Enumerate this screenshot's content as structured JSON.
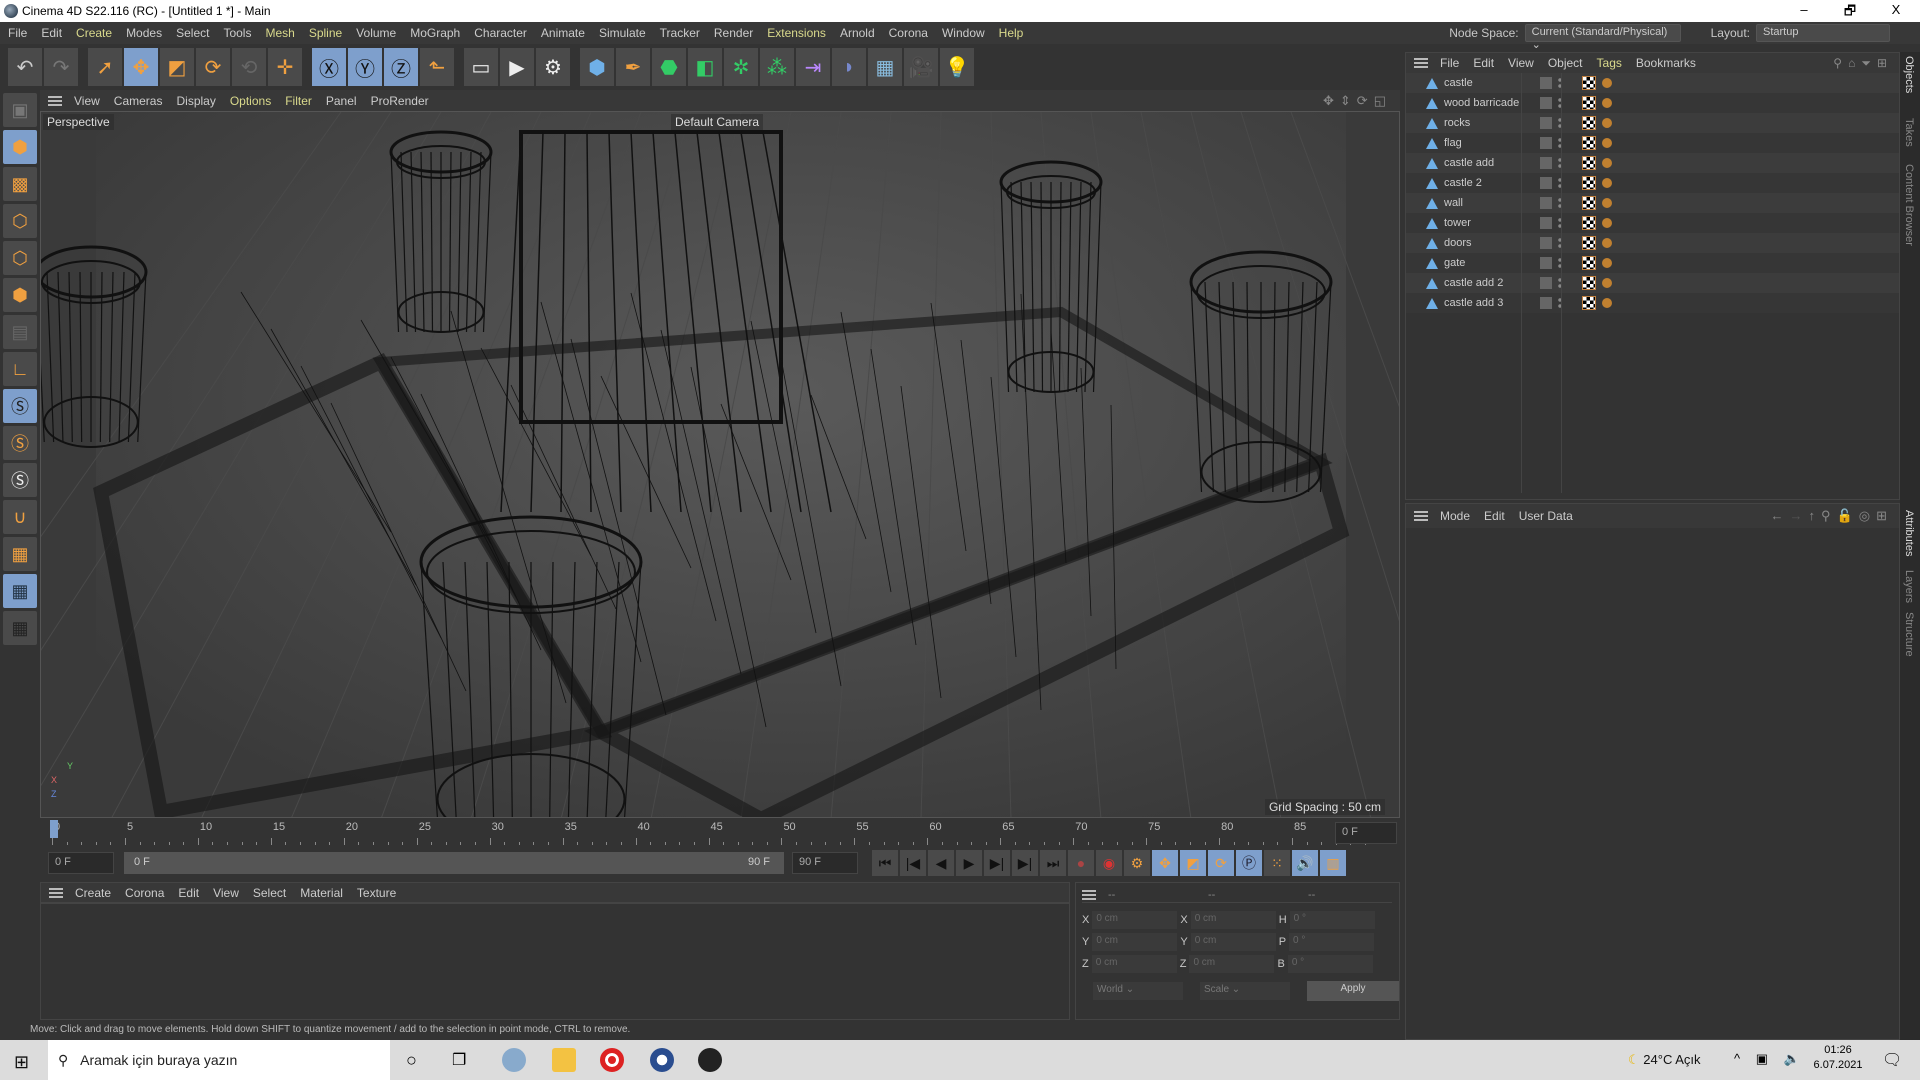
{
  "window": {
    "title": "Cinema 4D S22.116 (RC) - [Untitled 1 *] - Main",
    "minimize": "–",
    "maximize": "🗗",
    "close": "X"
  },
  "menu": [
    "File",
    "Edit",
    "Create",
    "Modes",
    "Select",
    "Tools",
    "Mesh",
    "Spline",
    "Volume",
    "MoGraph",
    "Character",
    "Animate",
    "Simulate",
    "Tracker",
    "Render",
    "Extensions",
    "Arnold",
    "Corona",
    "Window",
    "Help"
  ],
  "menu_highlight": [
    "Create",
    "Mesh",
    "Spline",
    "Extensions",
    "Help"
  ],
  "node_space": {
    "label": "Node Space:",
    "value": "Current (Standard/Physical)"
  },
  "layout": {
    "label": "Layout:",
    "value": "Startup"
  },
  "toolbar": [
    {
      "icon": "undo-icon",
      "g": "↶",
      "c": "#ccc"
    },
    {
      "icon": "redo-icon",
      "g": "↷",
      "c": "#777"
    },
    {
      "gap": true
    },
    {
      "icon": "live-selection-icon",
      "g": "➚",
      "on": false
    },
    {
      "icon": "move-icon",
      "g": "✥",
      "on": true
    },
    {
      "icon": "scale-icon",
      "g": "◩"
    },
    {
      "icon": "rotate-icon",
      "g": "⟳"
    },
    {
      "icon": "psr-icon",
      "g": "⟲",
      "c": "#666"
    },
    {
      "icon": "add-icon",
      "g": "✛"
    },
    {
      "gap": true
    },
    {
      "icon": "x-axis-icon",
      "g": "Ⓧ",
      "on": true,
      "c": "#111"
    },
    {
      "icon": "y-axis-icon",
      "g": "Ⓨ",
      "on": true,
      "c": "#111"
    },
    {
      "icon": "z-axis-icon",
      "g": "Ⓩ",
      "on": true,
      "c": "#111"
    },
    {
      "icon": "coordinate-system-icon",
      "g": "⬑"
    },
    {
      "gap": true
    },
    {
      "icon": "render-view-icon",
      "g": "▭",
      "c": "#eee"
    },
    {
      "icon": "render-picture-viewer-icon",
      "g": "▶",
      "c": "#eee"
    },
    {
      "icon": "render-settings-icon",
      "g": "⚙",
      "c": "#eee"
    },
    {
      "gap": true
    },
    {
      "icon": "cube-icon",
      "g": "⬢",
      "c": "#6fb0e8"
    },
    {
      "icon": "pen-spline-icon",
      "g": "✒",
      "c": "#f0a040"
    },
    {
      "icon": "subdivision-icon",
      "g": "⬣",
      "c": "#3c6"
    },
    {
      "icon": "extrude-icon",
      "g": "◧",
      "c": "#3c6"
    },
    {
      "icon": "cloner-icon",
      "g": "✲",
      "c": "#3c6"
    },
    {
      "icon": "mograph-icon",
      "g": "⁂",
      "c": "#3c6"
    },
    {
      "icon": "deformer-icon",
      "g": "⇥",
      "c": "#b8f"
    },
    {
      "icon": "field-icon",
      "g": "◗",
      "c": "#78c"
    },
    {
      "icon": "floor-icon",
      "g": "▦",
      "c": "#8bd"
    },
    {
      "icon": "camera-icon",
      "g": "🎥",
      "c": "#eee"
    },
    {
      "icon": "light-icon",
      "g": "💡",
      "c": "#eee"
    }
  ],
  "left_tools": [
    {
      "icon": "make-editable-icon",
      "g": "▣",
      "c": "#777"
    },
    {
      "icon": "model-mode-icon",
      "g": "⬢",
      "on": true
    },
    {
      "icon": "texture-mode-icon",
      "g": "▩"
    },
    {
      "icon": "points-mode-icon",
      "g": "⬡"
    },
    {
      "icon": "edges-mode-icon",
      "g": "⬡"
    },
    {
      "icon": "polygons-mode-icon",
      "g": "⬢"
    },
    {
      "icon": "uv-mode-icon",
      "g": "▤",
      "c": "#666"
    },
    {
      "icon": "axis-mode-icon",
      "g": "∟"
    },
    {
      "icon": "snap-icon",
      "g": "Ⓢ",
      "on": true,
      "c": "#222"
    },
    {
      "icon": "snap-settings-icon",
      "g": "Ⓢ"
    },
    {
      "icon": "quantize-icon",
      "g": "Ⓢ",
      "c": "#eee"
    },
    {
      "icon": "tweak-magnet-icon",
      "g": "∪"
    },
    {
      "icon": "workplane-icon",
      "g": "▦"
    },
    {
      "icon": "locked-workplane-icon",
      "g": "▦",
      "on": true,
      "c": "#234"
    },
    {
      "icon": "workplane-align-icon",
      "g": "▦",
      "c": "#222"
    }
  ],
  "viewport": {
    "menu": [
      "View",
      "Cameras",
      "Display",
      "Options",
      "Filter",
      "Panel",
      "ProRender"
    ],
    "menu_highlight": [
      "Options",
      "Filter"
    ],
    "view_name": "Perspective",
    "camera": "Default Camera",
    "grid_spacing": "Grid Spacing : 50 cm",
    "axis": {
      "x": "X",
      "y": "Y",
      "z": "Z"
    }
  },
  "timeline": {
    "start": 0,
    "end": 90,
    "major_step": 5,
    "current": 0,
    "current_label": "0 F"
  },
  "frames": {
    "current": "0 F",
    "range_start": "0 F",
    "range_end": "90 F",
    "max": "90 F"
  },
  "material_menu": [
    "Create",
    "Corona",
    "Edit",
    "View",
    "Select",
    "Material",
    "Texture"
  ],
  "coordinates": {
    "headers": [
      "--",
      "--",
      "--"
    ],
    "rows": [
      {
        "a": "X",
        "av": "0 cm",
        "b": "X",
        "bv": "0 cm",
        "c": "H",
        "cv": "0 °"
      },
      {
        "a": "Y",
        "av": "0 cm",
        "b": "Y",
        "bv": "0 cm",
        "c": "P",
        "cv": "0 °"
      },
      {
        "a": "Z",
        "av": "0 cm",
        "b": "Z",
        "bv": "0 cm",
        "c": "B",
        "cv": "0 °"
      }
    ],
    "space": "World",
    "mode": "Scale",
    "apply": "Apply"
  },
  "status": "Move: Click and drag to move elements. Hold down SHIFT to quantize movement / add to the selection in point mode, CTRL to remove.",
  "objects": {
    "menu": [
      "File",
      "Edit",
      "View",
      "Object",
      "Tags",
      "Bookmarks"
    ],
    "menu_highlight": [
      "Tags"
    ],
    "items": [
      "castle",
      "wood barricade",
      "rocks",
      "flag",
      "castle add",
      "castle 2",
      "wall",
      "tower",
      "doors",
      "gate",
      "castle add 2",
      "castle add 3"
    ]
  },
  "attributes": {
    "menu": [
      "Mode",
      "Edit",
      "User Data"
    ]
  },
  "side_tabs_top": [
    "Objects",
    "Takes",
    "Content Browser"
  ],
  "side_tabs_bottom": [
    "Attributes",
    "Layers",
    "Structure"
  ],
  "taskbar": {
    "search_placeholder": "Aramak için buraya yazın",
    "weather": "24°C  Açık",
    "time": "01:26",
    "date": "6.07.2021"
  }
}
